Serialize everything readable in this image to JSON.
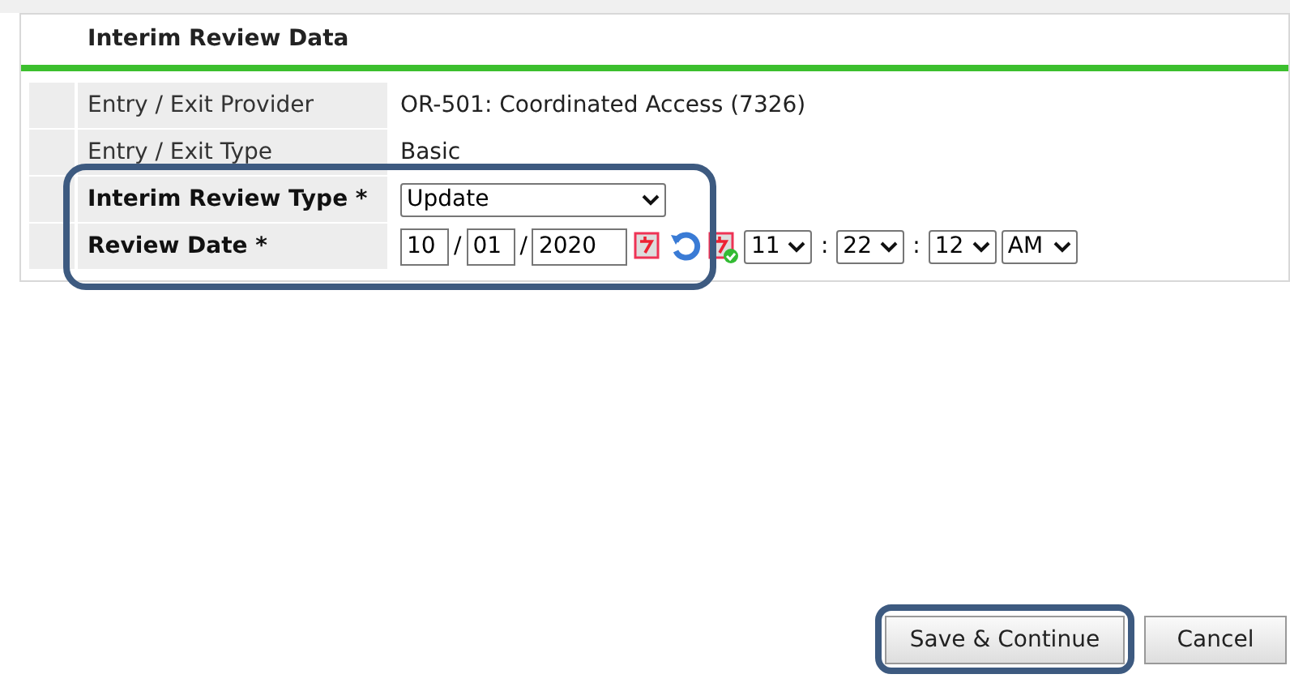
{
  "panel": {
    "title": "Interim Review Data"
  },
  "rows": [
    {
      "kind": "text",
      "label": "Entry / Exit Provider",
      "required": false,
      "highlighted": false,
      "value": "OR-501: Coordinated Access (7326)"
    },
    {
      "kind": "text",
      "label": "Entry / Exit Type",
      "required": false,
      "highlighted": false,
      "value": "Basic"
    },
    {
      "kind": "select",
      "label": "Interim Review Type *",
      "required": true,
      "highlighted": true,
      "value": "Update"
    },
    {
      "kind": "datetime",
      "label": "Review Date *",
      "required": true,
      "highlighted": true,
      "month": "10",
      "day": "01",
      "year": "2020",
      "sep": "/",
      "hour": "11",
      "minute": "22",
      "second": "12",
      "ampm": "AM",
      "colon": ":"
    }
  ],
  "buttons": [
    {
      "label": "Save & Continue",
      "highlighted": true
    },
    {
      "label": "Cancel",
      "highlighted": false
    }
  ]
}
